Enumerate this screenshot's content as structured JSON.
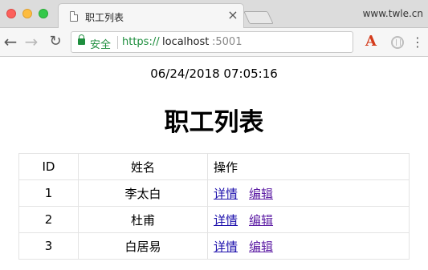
{
  "browser": {
    "tab_title": "职工列表",
    "profile_label": "www.twle.cn",
    "secure_label": "安全",
    "url_scheme": "https://",
    "url_host": "localhost",
    "url_port": ":5001",
    "icons": {
      "back": "arrow-left-icon",
      "forward": "arrow-right-icon",
      "reload": "reload-icon",
      "lock": "lock-icon",
      "menu": "more-vertical-icon"
    },
    "ext_a_label": "A",
    "close_glyph": "×",
    "menu_glyph": "⋮",
    "back_glyph": "←",
    "forward_glyph": "→",
    "reload_glyph": "↻"
  },
  "page": {
    "timestamp": "06/24/2018 07:05:16",
    "title": "职工列表",
    "table": {
      "headers": [
        "ID",
        "姓名",
        "操作"
      ],
      "rows": [
        {
          "id": "1",
          "name": "李太白",
          "actions": [
            "详情",
            "编辑"
          ]
        },
        {
          "id": "2",
          "name": "杜甫",
          "actions": [
            "详情",
            "编辑"
          ]
        },
        {
          "id": "3",
          "name": "白居易",
          "actions": [
            "详情",
            "编辑"
          ]
        }
      ]
    }
  },
  "colors": {
    "secure_green": "#1e8e3e",
    "link_blue": "#1a0dab",
    "link_visited": "#5b1aa3"
  }
}
